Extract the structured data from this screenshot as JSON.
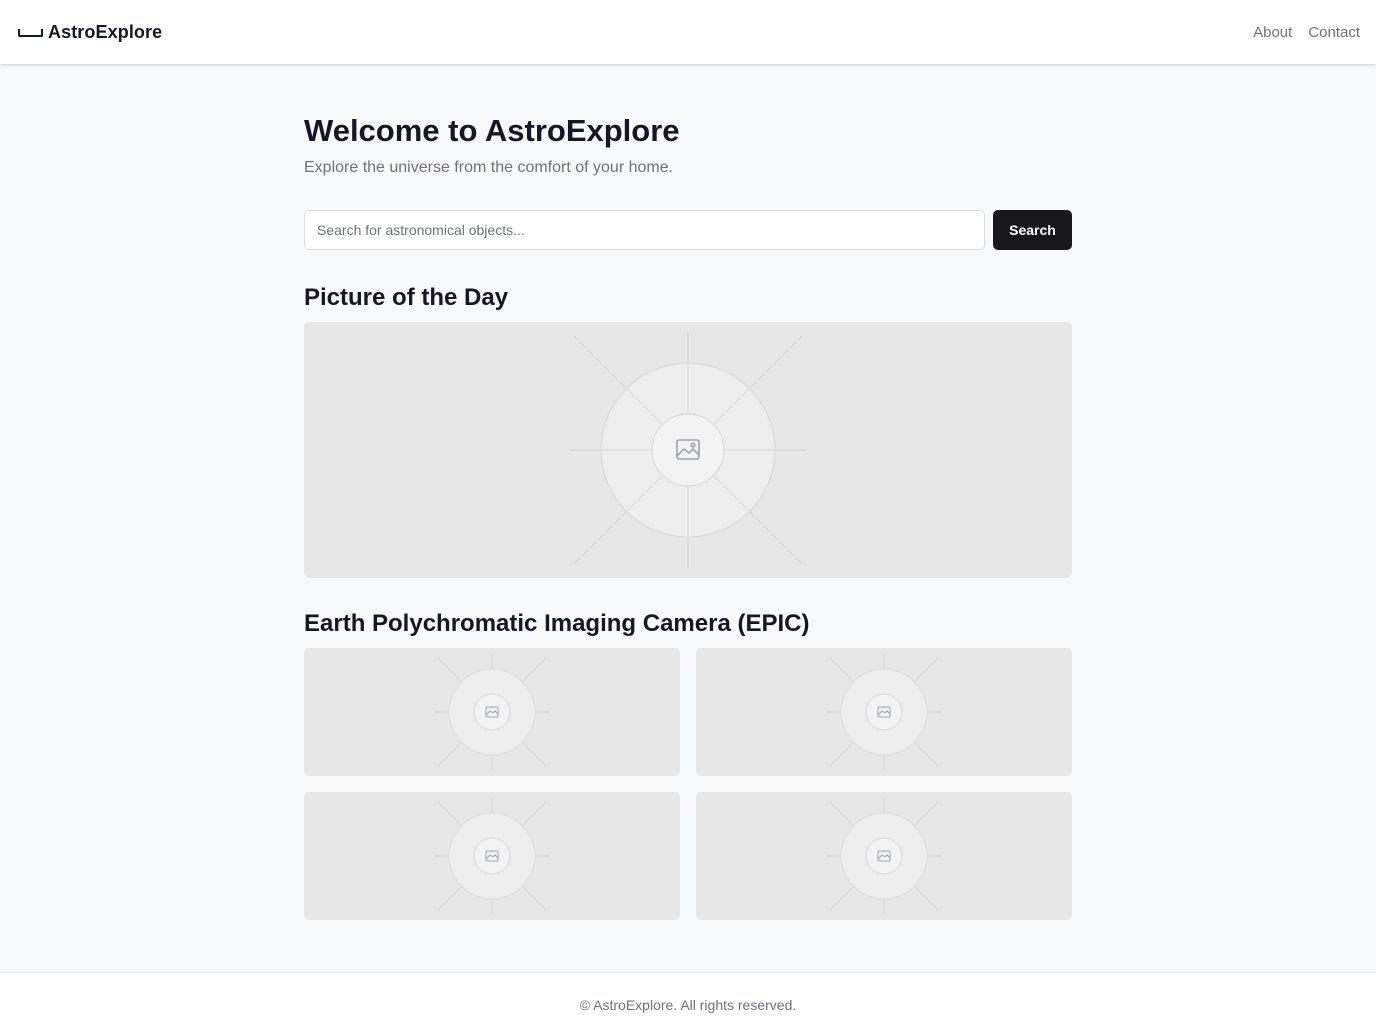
{
  "header": {
    "brand_icon": "telescope-icon",
    "brand_name": "AstroExplore",
    "nav": [
      {
        "label": "About"
      },
      {
        "label": "Contact"
      }
    ]
  },
  "hero": {
    "title": "Welcome to AstroExplore",
    "subtitle": "Explore the universe from the comfort of your home."
  },
  "search": {
    "placeholder": "Search for astronomical objects...",
    "value": "",
    "button_label": "Search"
  },
  "picture_of_the_day": {
    "title": "Picture of the Day",
    "image_icon": "image-placeholder-icon"
  },
  "epic": {
    "title": "Earth Polychromatic Imaging Camera (EPIC)",
    "image_count_shown": 4,
    "image_icon": "image-placeholder-icon"
  },
  "footer": {
    "text": "© AstroExplore. All rights reserved."
  },
  "colors": {
    "page_background": "#f8f9fa",
    "primary_button": "#18181b",
    "placeholder_background": "#e8e8e8",
    "muted_text": "#6b7280",
    "heading_text": "#111827"
  }
}
